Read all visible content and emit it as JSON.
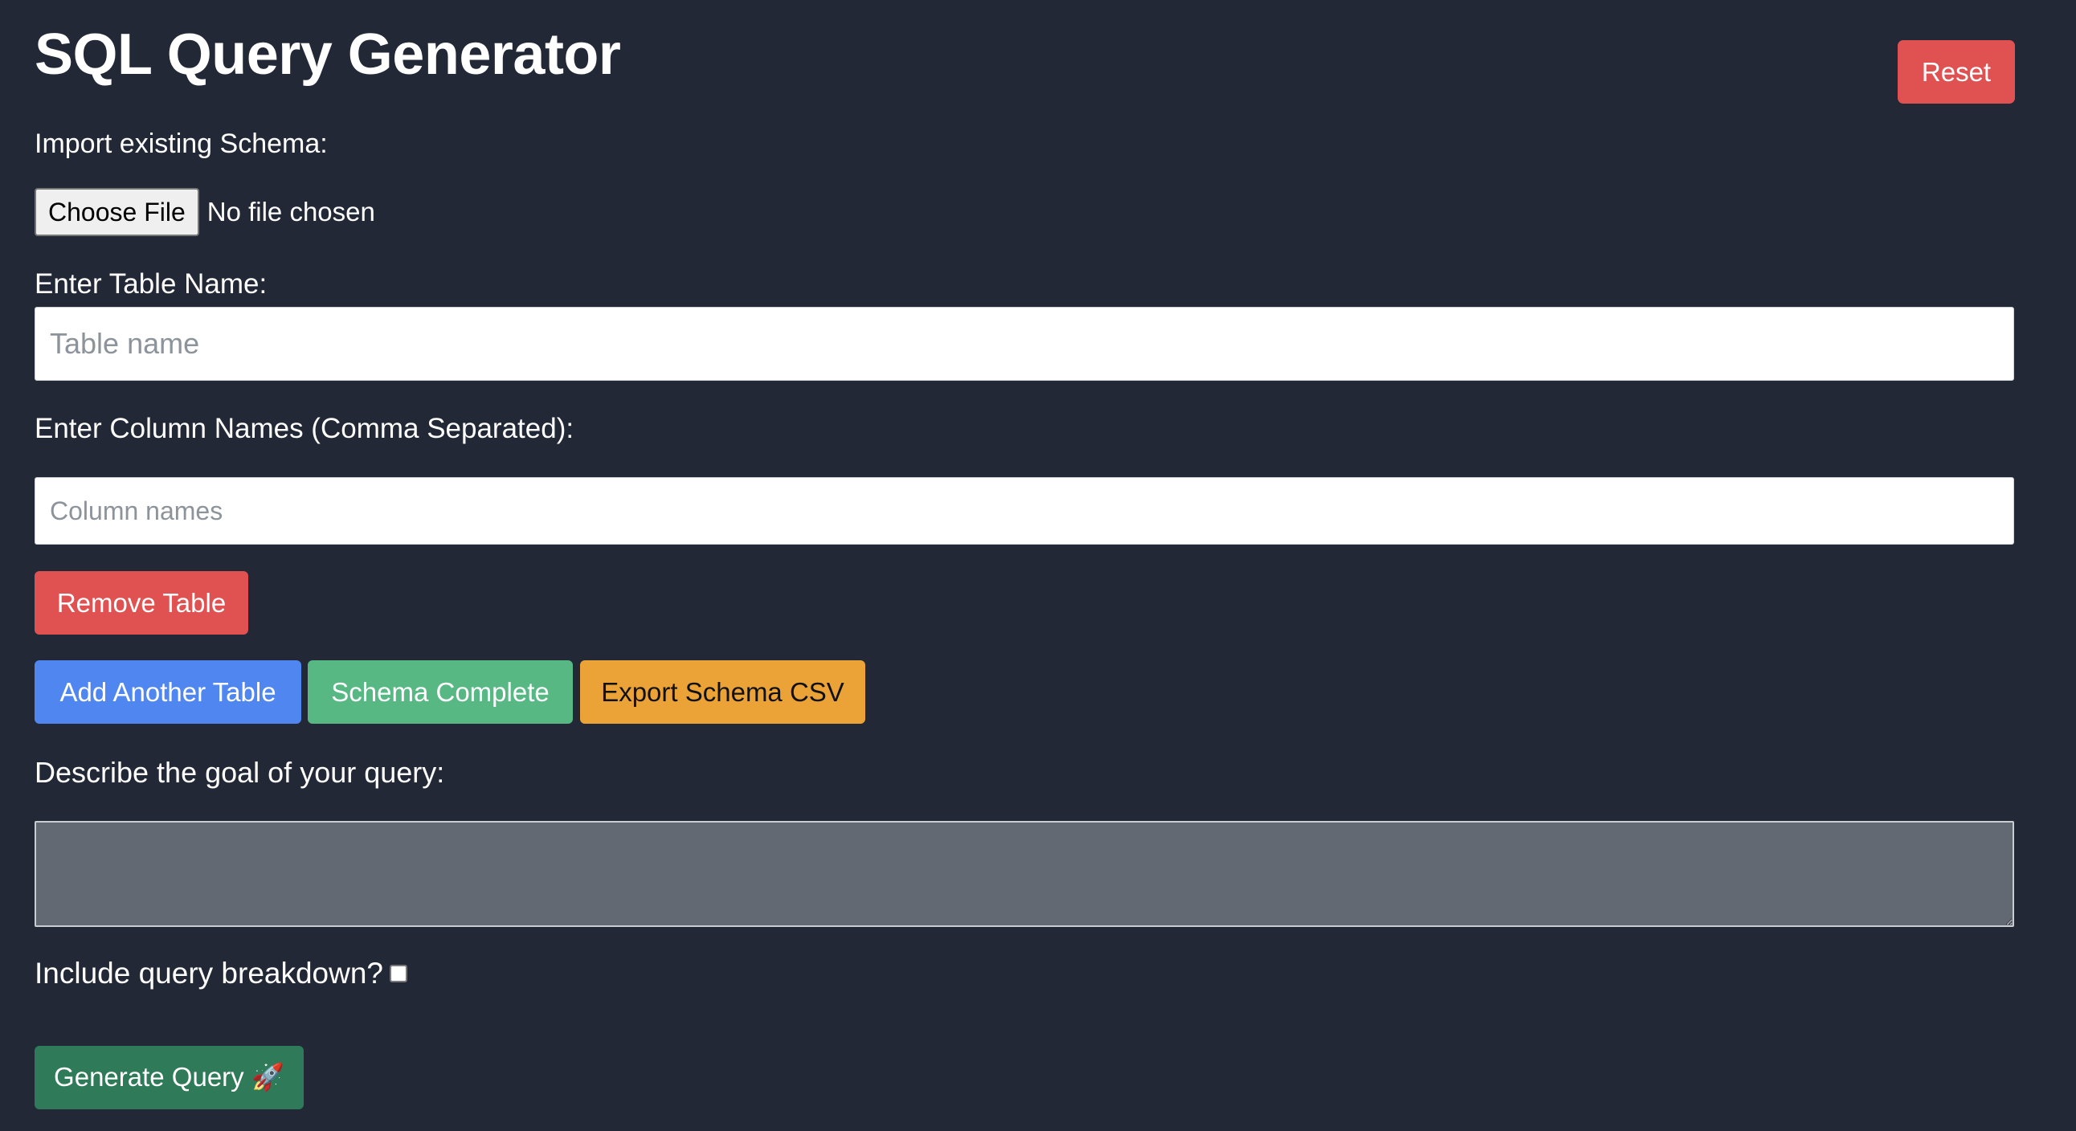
{
  "header": {
    "title": "SQL Query Generator",
    "reset_label": "Reset"
  },
  "import": {
    "label": "Import existing Schema:",
    "choose_file_label": "Choose File",
    "file_status": "No file chosen"
  },
  "table": {
    "name_label": "Enter Table Name:",
    "name_placeholder": "Table name",
    "name_value": "",
    "columns_label": "Enter Column Names (Comma Separated):",
    "columns_placeholder": "Column names",
    "columns_value": "",
    "remove_label": "Remove Table"
  },
  "actions": {
    "add_table_label": "Add Another Table",
    "schema_complete_label": "Schema Complete",
    "export_csv_label": "Export Schema CSV"
  },
  "query": {
    "goal_label": "Describe the goal of your query:",
    "goal_value": "",
    "breakdown_label": "Include query breakdown?",
    "breakdown_checked": false,
    "generate_label": "Generate Query 🚀"
  },
  "colors": {
    "background": "#222835",
    "danger": "#e05252",
    "primary": "#4f86f0",
    "success": "#58b884",
    "warning": "#eba338",
    "generate": "#2f7a58"
  }
}
